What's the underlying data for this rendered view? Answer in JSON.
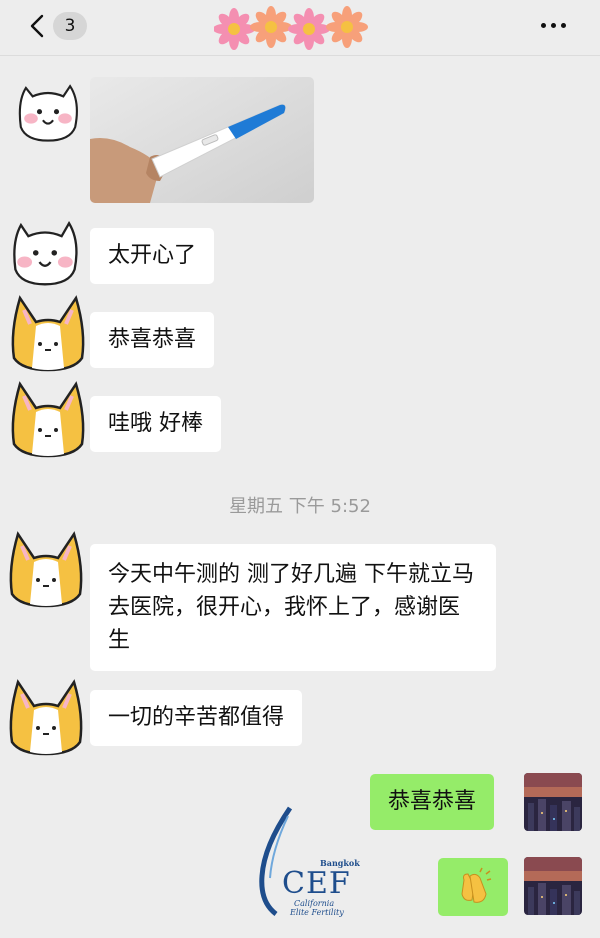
{
  "header": {
    "unread_count": "3",
    "title_decoration": "flower-emoji-row",
    "more_icon": "more-dots-icon"
  },
  "messages": [
    {
      "side": "left",
      "type": "image",
      "avatar": "white-cat-sticker",
      "image": "pregnancy-test-photo"
    },
    {
      "side": "left",
      "type": "text",
      "avatar": "white-cat-sticker",
      "text": "太开心了"
    },
    {
      "side": "left",
      "type": "text",
      "avatar": "corgi-sticker",
      "text": "恭喜恭喜"
    },
    {
      "side": "left",
      "type": "text",
      "avatar": "corgi-sticker",
      "text": "哇哦 好棒"
    },
    {
      "side": "left",
      "type": "text",
      "avatar": "corgi-sticker",
      "text": "今天中午测的 测了好几遍 下午就立马去医院，很开心，我怀上了，感谢医生"
    },
    {
      "side": "left",
      "type": "text",
      "avatar": "corgi-sticker",
      "text": "一切的辛苦都值得"
    },
    {
      "side": "right",
      "type": "text",
      "avatar": "city-night-photo",
      "text": "恭喜恭喜"
    },
    {
      "side": "right",
      "type": "emoji",
      "avatar": "city-night-photo",
      "emoji": "clapping-hands-icon"
    }
  ],
  "timestamp": "星期五 下午 5:52",
  "watermark": {
    "brand": "CEF",
    "city": "Bangkok",
    "line1": "California",
    "line2": "Elite Fertility"
  },
  "colors": {
    "background": "#ededed",
    "bubble_left": "#ffffff",
    "bubble_right": "#95ec69",
    "logo_blue": "#1e4d8c"
  }
}
